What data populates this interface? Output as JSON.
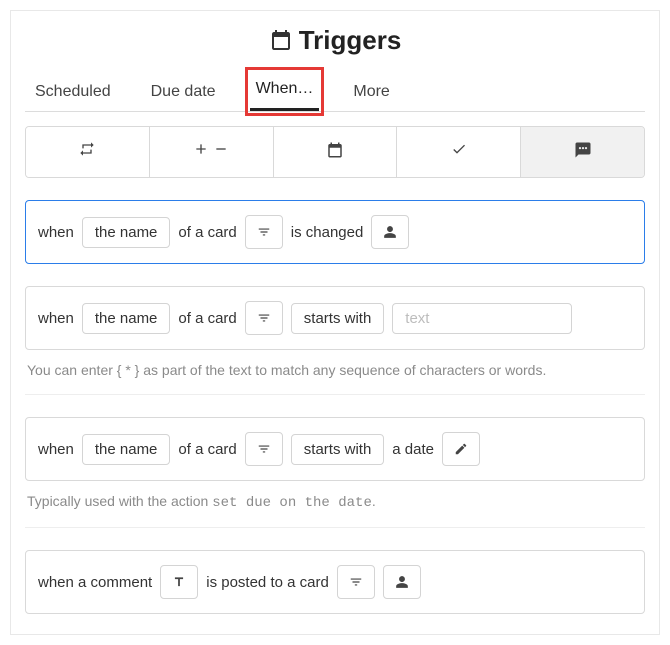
{
  "title": "Triggers",
  "tabs": [
    "Scheduled",
    "Due date",
    "When…",
    "More"
  ],
  "active_tab": 2,
  "iconrow_active": 4,
  "rules": {
    "r1": {
      "prefix": "when",
      "field": "the name",
      "mid": "of a card",
      "suffix": "is changed"
    },
    "r2": {
      "prefix": "when",
      "field": "the name",
      "mid": "of a card",
      "cond": "starts with",
      "placeholder": "text"
    },
    "hint1": "You can enter  { * }  as part of the text to match any sequence of characters or words.",
    "r3": {
      "prefix": "when",
      "field": "the name",
      "mid": "of a card",
      "cond": "starts with",
      "suffix": "a date"
    },
    "hint2_a": "Typically used with the action ",
    "hint2_b": "set due on the date",
    "hint2_c": ".",
    "r4": {
      "prefix": "when a comment",
      "mid": "is posted to a card"
    }
  }
}
